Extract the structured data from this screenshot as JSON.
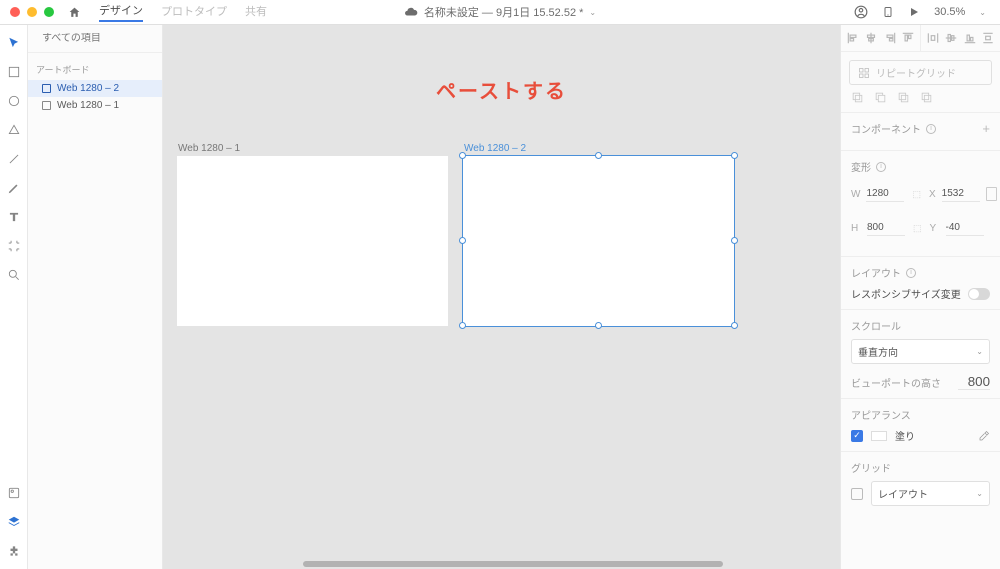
{
  "titlebar": {
    "tabs": {
      "design": "デザイン",
      "prototype": "プロトタイプ",
      "share": "共有"
    },
    "doc_title": "名称未設定 — 9月1日 15.52.52 *",
    "zoom": "30.5%"
  },
  "sidebar": {
    "search_placeholder": "すべての項目",
    "section": "アートボード",
    "layers": [
      {
        "name": "Web 1280 – 2",
        "selected": true
      },
      {
        "name": "Web 1280 – 1",
        "selected": false
      }
    ]
  },
  "canvas": {
    "annotation": "ペーストする",
    "artboards": [
      {
        "label": "Web 1280 – 1",
        "selected": false
      },
      {
        "label": "Web 1280 – 2",
        "selected": true
      }
    ]
  },
  "rpanel": {
    "repeat_grid": "リピートグリッド",
    "component": "コンポーネント",
    "transform": "変形",
    "w": "1280",
    "h": "800",
    "x": "1532",
    "y": "-40",
    "layout": "レイアウト",
    "responsive": "レスポンシブサイズ変更",
    "scroll": "スクロール",
    "scroll_val": "垂直方向",
    "viewport": "ビューポートの高さ",
    "viewport_val": "800",
    "appearance": "アピアランス",
    "fill": "塗り",
    "grid": "グリッド",
    "grid_val": "レイアウト"
  }
}
